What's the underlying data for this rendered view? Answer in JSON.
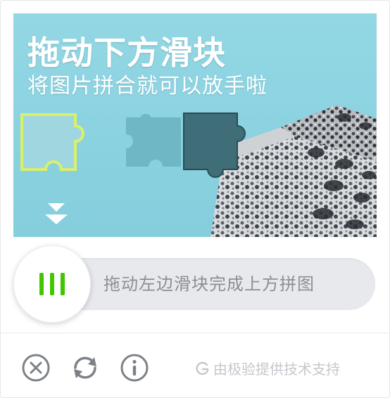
{
  "captcha": {
    "title": "拖动下方滑块",
    "subtitle": "将图片拼合就可以放手啦",
    "slider_hint": "拖动左边滑块完成上方拼图",
    "slider_progress": 0,
    "accent_color": "#43c600",
    "background_color": "#8fd3e0"
  },
  "footer": {
    "close_icon": "close-circle-icon",
    "refresh_icon": "refresh-icon",
    "info_icon": "info-icon",
    "brand_text": "由极验提供技术支持"
  }
}
